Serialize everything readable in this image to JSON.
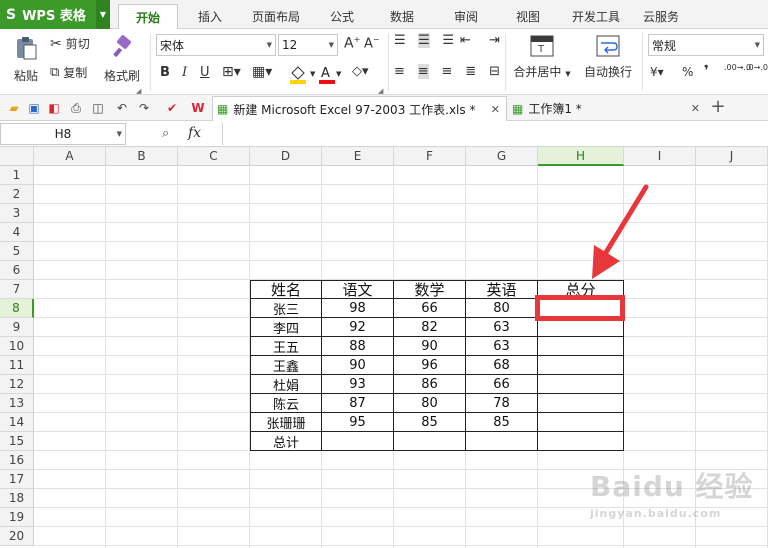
{
  "app": {
    "name": "WPS 表格",
    "logo": "S"
  },
  "menu": {
    "tabs": [
      "开始",
      "插入",
      "页面布局",
      "公式",
      "数据",
      "审阅",
      "视图",
      "开发工具",
      "云服务"
    ],
    "active": 0
  },
  "ribbon": {
    "paste": "粘贴",
    "cut": "剪切",
    "copy": "复制",
    "format_painter": "格式刷",
    "font_name": "宋体",
    "font_size": "12",
    "merge_center": "合并居中",
    "wrap_text": "自动换行",
    "number_format": "常规",
    "percent": "%",
    "comma": "❜",
    "dec_inc": ".00→.0",
    "dec_dec": ".0→.00"
  },
  "doctabs": [
    {
      "label": "新建 Microsoft Excel 97-2003 工作表.xls *"
    },
    {
      "label": "工作簿1 *"
    }
  ],
  "formula_bar": {
    "name_box": "H8",
    "fx": "fx",
    "value": ""
  },
  "grid": {
    "columns": [
      "A",
      "B",
      "C",
      "D",
      "E",
      "F",
      "G",
      "H",
      "I",
      "J"
    ],
    "rows": [
      "1",
      "2",
      "3",
      "4",
      "5",
      "6",
      "7",
      "8",
      "9",
      "10",
      "11",
      "12",
      "13",
      "14",
      "15",
      "16",
      "17",
      "18",
      "19",
      "20"
    ],
    "selected_col": "H",
    "selected_row": "8"
  },
  "table": {
    "headers": [
      "姓名",
      "语文",
      "数学",
      "英语",
      "总分"
    ],
    "rows": [
      [
        "张三",
        "98",
        "66",
        "80",
        ""
      ],
      [
        "李四",
        "92",
        "82",
        "63",
        ""
      ],
      [
        "王五",
        "88",
        "90",
        "63",
        ""
      ],
      [
        "王鑫",
        "90",
        "96",
        "68",
        ""
      ],
      [
        "杜娟",
        "93",
        "86",
        "66",
        ""
      ],
      [
        "陈云",
        "87",
        "80",
        "78",
        ""
      ],
      [
        "张珊珊",
        "95",
        "85",
        "85",
        ""
      ],
      [
        "总计",
        "",
        "",
        "",
        ""
      ]
    ]
  },
  "colors": {
    "accent": "#3c9a2a",
    "highlight": "#e8373a"
  }
}
